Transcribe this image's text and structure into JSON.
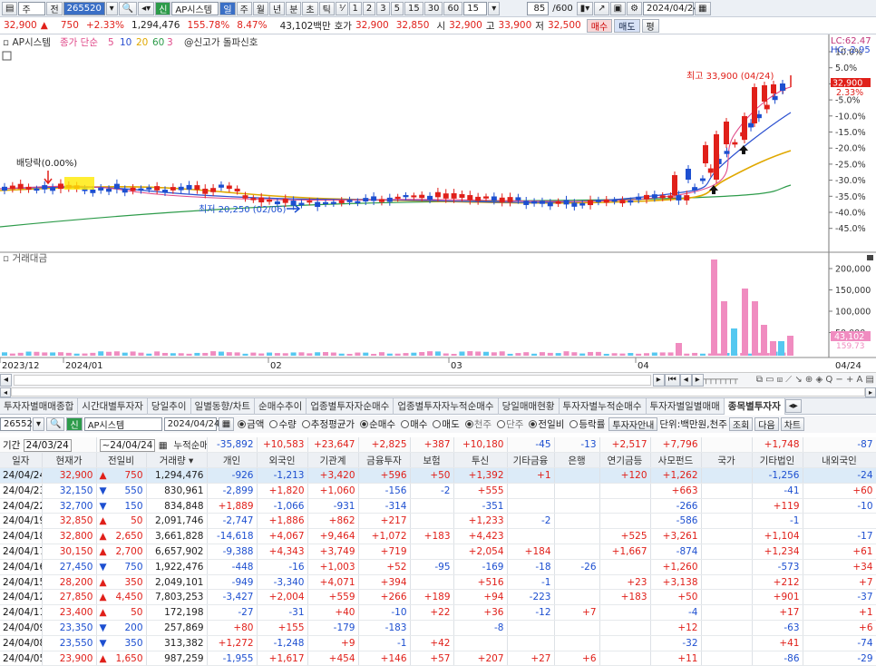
{
  "toolbar": {
    "type": "주",
    "jeon": "전",
    "code": "265520",
    "stock": "AP시스템",
    "period_day": "일",
    "period_week": "주",
    "period_month": "월",
    "period_year": "년",
    "period_min": "분",
    "period_sec": "초",
    "period_tick": "틱",
    "frac": "⅟",
    "n1": "1",
    "n2": "2",
    "n3": "3",
    "n5": "5",
    "n15": "15",
    "n30": "30",
    "n60": "60",
    "n_sel": "15",
    "count": "85",
    "total": "/600",
    "date": "2024/04/24"
  },
  "info": {
    "price": "32,900",
    "change": "750",
    "rate": "+2.33%",
    "volume": "1,294,476",
    "vol_rate": "155.78%",
    "turnover": "8.47%",
    "amount": "43,102백만",
    "ask_label": "호가",
    "ask": "32,900",
    "bid": "32,850",
    "open_label": "시",
    "open": "32,900",
    "high_label": "고",
    "high": "33,900",
    "low_label": "저",
    "low": "32,500",
    "buy": "매수",
    "sell": "매도",
    "avg": "평"
  },
  "chart": {
    "legend_name": "AP시스템",
    "legend_ma": "종가 단순",
    "ma5": "5",
    "ma10": "10",
    "ma20": "20",
    "ma60": "60",
    "ma3": "3",
    "signal": "@신고가 돌파신호",
    "lc": "LC:62.47",
    "hc": "HC:-2.95",
    "high_note": "최고 33,900 (04/24)",
    "low_note": "최저 20,250 (02/06)",
    "div_note": "배당락(0.00%)",
    "price_tag": "32,900",
    "rate_tag": "2.33%",
    "vol_label": "거래대금",
    "vol_tag": "43,102",
    "vol_tag2": "159.73",
    "y_ticks": [
      "10.0%",
      "5.0%",
      "0.0%",
      "-5.0%",
      "-10.0%",
      "-15.0%",
      "-20.0%",
      "-25.0%",
      "-30.0%",
      "-35.0%",
      "-40.0%",
      "-45.0%"
    ],
    "v_ticks": [
      "200,000",
      "150,000",
      "100,000",
      "50,000"
    ],
    "x_ticks": [
      "2023/12",
      "2024/01",
      "02",
      "03",
      "04",
      "04/24"
    ]
  },
  "tabs": [
    "투자자별매매종합",
    "시간대별투자자",
    "당일추이",
    "일별동향/차트",
    "순매수추이",
    "업종별투자자순매수",
    "업종별투자자누적순매수",
    "당일매매현황",
    "투자자별누적순매수",
    "투자자별일별매매",
    "종목별투자자"
  ],
  "controls": {
    "code": "265520",
    "stock": "AP시스템",
    "date": "2024/04/24",
    "r_amount": "금액",
    "r_qty": "수량",
    "r_avg": "추정평균가",
    "r_net": "순매수",
    "r_buy": "매수",
    "r_sell": "매도",
    "r_cur": "천주",
    "r_unit": "단주",
    "r_prev": "전일비",
    "r_rate": "등락률",
    "guide": "투자자안내",
    "unit": "단위:백만원,천주",
    "query": "조회",
    "next": "다음",
    "chart": "차트"
  },
  "period": {
    "label": "기간",
    "from": "24/03/24",
    "to": "24/04/24",
    "cum": "누적순매수",
    "sums": [
      "-35,892",
      "+10,583",
      "+23,647",
      "+2,825",
      "+387",
      "+10,180",
      "-45",
      "-13",
      "+2,517",
      "+7,796",
      "",
      "+1,748",
      "-87"
    ]
  },
  "headers": [
    "일자",
    "현재가",
    "전일비",
    "거래량",
    "개인",
    "외국인",
    "기관계",
    "금융투자",
    "보험",
    "투신",
    "기타금융",
    "은행",
    "연기금등",
    "사모펀드",
    "국가",
    "기타법인",
    "내외국인"
  ],
  "rows": [
    [
      "24/04/24",
      "32,900",
      "▲",
      "750",
      "1,294,476",
      "-926",
      "-1,213",
      "+3,420",
      "+596",
      "+50",
      "+1,392",
      "+1",
      "",
      "+120",
      "+1,262",
      "",
      "-1,256",
      "-24"
    ],
    [
      "24/04/23",
      "32,150",
      "▼",
      "550",
      "830,961",
      "-2,899",
      "+1,820",
      "+1,060",
      "-156",
      "-2",
      "+555",
      "",
      "",
      "",
      "+663",
      "",
      "-41",
      "+60"
    ],
    [
      "24/04/22",
      "32,700",
      "▼",
      "150",
      "834,848",
      "+1,889",
      "-1,066",
      "-931",
      "-314",
      "",
      "-351",
      "",
      "",
      "",
      "-266",
      "",
      "+119",
      "-10"
    ],
    [
      "24/04/19",
      "32,850",
      "▲",
      "50",
      "2,091,746",
      "-2,747",
      "+1,886",
      "+862",
      "+217",
      "",
      "+1,233",
      "-2",
      "",
      "",
      "-586",
      "",
      "-1",
      ""
    ],
    [
      "24/04/18",
      "32,800",
      "▲",
      "2,650",
      "3,661,828",
      "-14,618",
      "+4,067",
      "+9,464",
      "+1,072",
      "+183",
      "+4,423",
      "",
      "",
      "+525",
      "+3,261",
      "",
      "+1,104",
      "-17"
    ],
    [
      "24/04/17",
      "30,150",
      "▲",
      "2,700",
      "6,657,902",
      "-9,388",
      "+4,343",
      "+3,749",
      "+719",
      "",
      "+2,054",
      "+184",
      "",
      "+1,667",
      "-874",
      "",
      "+1,234",
      "+61"
    ],
    [
      "24/04/16",
      "27,450",
      "▼",
      "750",
      "1,922,476",
      "-448",
      "-16",
      "+1,003",
      "+52",
      "-95",
      "-169",
      "-18",
      "-26",
      "",
      "+1,260",
      "",
      "-573",
      "+34"
    ],
    [
      "24/04/15",
      "28,200",
      "▲",
      "350",
      "2,049,101",
      "-949",
      "-3,340",
      "+4,071",
      "+394",
      "",
      "+516",
      "-1",
      "",
      "+23",
      "+3,138",
      "",
      "+212",
      "+7"
    ],
    [
      "24/04/12",
      "27,850",
      "▲",
      "4,450",
      "7,803,253",
      "-3,427",
      "+2,004",
      "+559",
      "+266",
      "+189",
      "+94",
      "-223",
      "",
      "+183",
      "+50",
      "",
      "+901",
      "-37"
    ],
    [
      "24/04/11",
      "23,400",
      "▲",
      "50",
      "172,198",
      "-27",
      "-31",
      "+40",
      "-10",
      "+22",
      "+36",
      "-12",
      "+7",
      "",
      "-4",
      "",
      "+17",
      "+1"
    ],
    [
      "24/04/09",
      "23,350",
      "▼",
      "200",
      "257,869",
      "+80",
      "+155",
      "-179",
      "-183",
      "",
      "-8",
      "",
      "",
      "",
      "+12",
      "",
      "-63",
      "+6"
    ],
    [
      "24/04/08",
      "23,550",
      "▼",
      "350",
      "313,382",
      "+1,272",
      "-1,248",
      "+9",
      "-1",
      "+42",
      "",
      "",
      "",
      "",
      "-32",
      "",
      "+41",
      "-74"
    ],
    [
      "24/04/05",
      "23,900",
      "▲",
      "1,650",
      "987,259",
      "-1,955",
      "+1,617",
      "+454",
      "+146",
      "+57",
      "+207",
      "+27",
      "+6",
      "",
      "+11",
      "",
      "-86",
      "-29"
    ]
  ]
}
